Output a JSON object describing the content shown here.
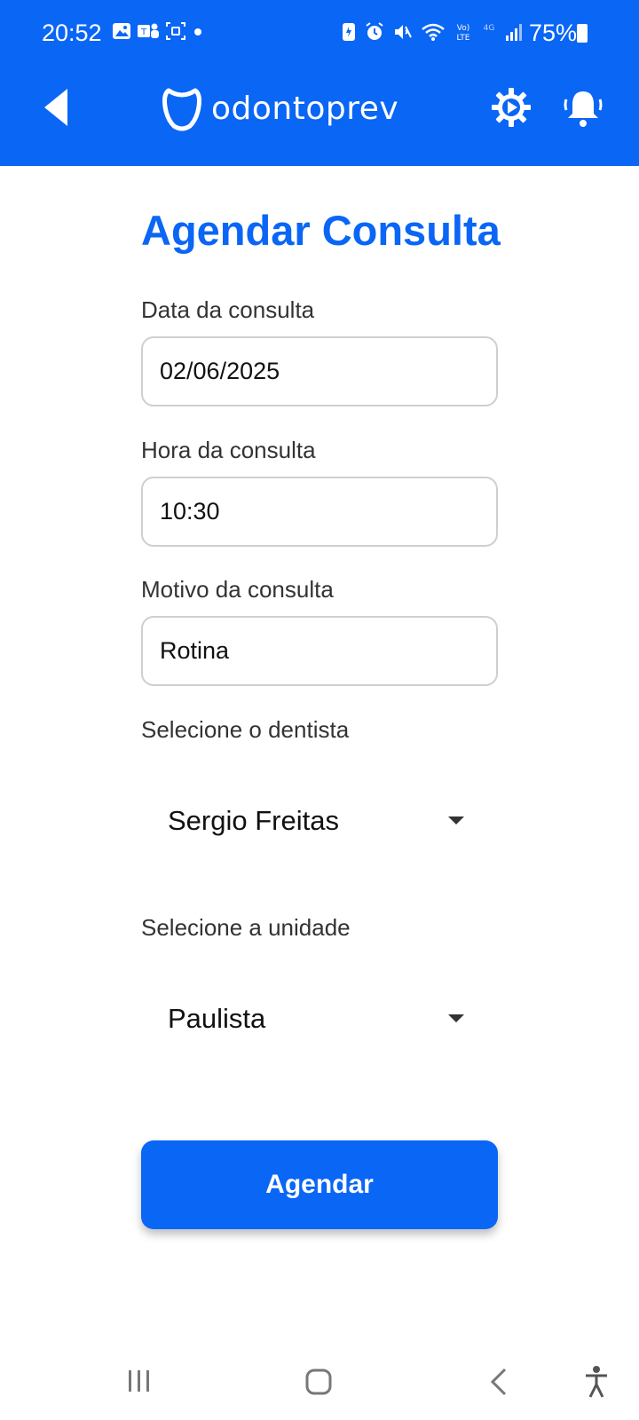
{
  "status_bar": {
    "time": "20:52",
    "battery": "75%"
  },
  "app_bar": {
    "brand": "odontoprev",
    "icons": [
      "back-icon",
      "tooth-logo-icon",
      "gear-icon",
      "bell-icon"
    ]
  },
  "form": {
    "title": "Agendar Consulta",
    "date_label": "Data da consulta",
    "date_value": "02/06/2025",
    "time_label": "Hora da consulta",
    "time_value": "10:30",
    "reason_label": "Motivo da consulta",
    "reason_value": "Rotina",
    "dentist_label": "Selecione o dentista",
    "dentist_value": "Sergio Freitas",
    "unit_label": "Selecione a unidade",
    "unit_value": "Paulista",
    "submit_label": "Agendar"
  },
  "colors": {
    "primary": "#0a66f5",
    "text": "#111111",
    "label": "#333333",
    "border": "#cfcfcf"
  }
}
